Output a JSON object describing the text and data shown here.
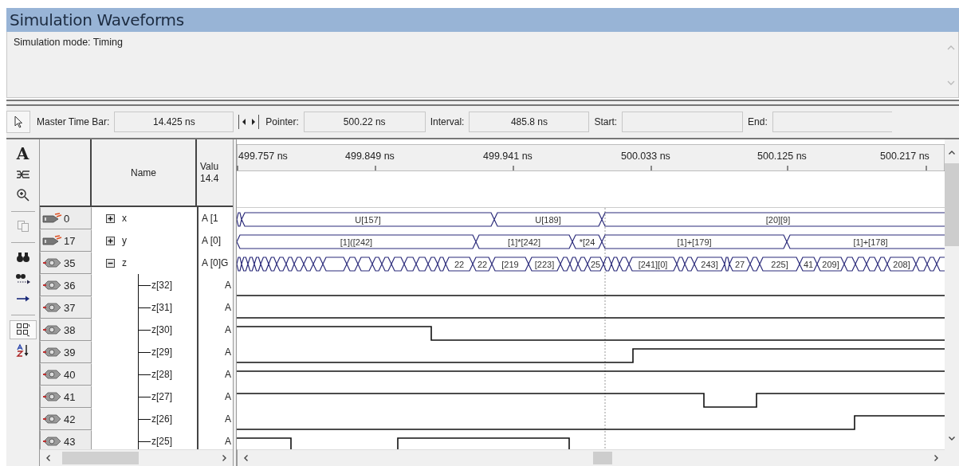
{
  "window": {
    "title": "Simulation Waveforms"
  },
  "info": {
    "text": "Simulation mode: Timing"
  },
  "toolbar": {
    "fields": [
      {
        "label": "Master Time Bar:",
        "value": "14.425 ns"
      },
      {
        "label": "Pointer:",
        "value": "500.22 ns"
      },
      {
        "label": "Interval:",
        "value": "485.8 ns"
      },
      {
        "label": "Start:"
      },
      {
        "label": "End:"
      }
    ]
  },
  "tool_groups": [
    [
      {
        "kind": "text",
        "label": "A",
        "selected": false
      },
      {
        "kind": "waveform-edit",
        "selected": false
      },
      {
        "kind": "zoom",
        "selected": false
      }
    ],
    [
      {
        "kind": "copy",
        "selected": false
      }
    ],
    [
      {
        "kind": "find",
        "selected": false
      },
      {
        "kind": "find-next",
        "selected": false
      },
      {
        "kind": "arrow",
        "selected": false
      }
    ],
    [
      {
        "kind": "grid",
        "selected": true
      },
      {
        "kind": "sort",
        "selected": false
      }
    ]
  ],
  "columns": {
    "name": "Name",
    "value": [
      "Valu",
      "14.4"
    ]
  },
  "time_labels": [
    "499.757 ns",
    "499.849 ns",
    "499.941 ns",
    "500.033 ns",
    "500.125 ns",
    "500.217 ns"
  ],
  "signals": [
    {
      "index": "0",
      "kind": "input",
      "name": "x",
      "expanded": false,
      "value": "A [1",
      "bus_labels": [
        "U[157]",
        "U[189]",
        "[20][9]"
      ]
    },
    {
      "index": "17",
      "kind": "input",
      "name": "y",
      "expanded": false,
      "value": "A [0]",
      "bus_labels": [
        "[1]([242]",
        "[1]*[242]",
        "*[24",
        "[1]+[179]",
        "[1]+[178]"
      ]
    },
    {
      "index": "35",
      "kind": "output",
      "name": "z",
      "expanded": true,
      "value": "A [0]G",
      "bus_labels": [
        "22",
        "22",
        "[219",
        "[223]",
        "25",
        "[241][0]",
        "243]",
        "27",
        "225]",
        "41",
        "209]",
        "208]"
      ],
      "children": [
        {
          "index": "36",
          "kind": "output",
          "name": "z[32]",
          "value": "A"
        },
        {
          "index": "37",
          "kind": "output",
          "name": "z[31]",
          "value": "A"
        },
        {
          "index": "38",
          "kind": "output",
          "name": "z[30]",
          "value": "A"
        },
        {
          "index": "39",
          "kind": "output",
          "name": "z[29]",
          "value": "A"
        },
        {
          "index": "40",
          "kind": "output",
          "name": "z[28]",
          "value": "A"
        },
        {
          "index": "41",
          "kind": "output",
          "name": "z[27]",
          "value": "A"
        },
        {
          "index": "42",
          "kind": "output",
          "name": "z[26]",
          "value": "A"
        },
        {
          "index": "43",
          "kind": "output",
          "name": "z[25]",
          "value": "A"
        }
      ]
    }
  ]
}
